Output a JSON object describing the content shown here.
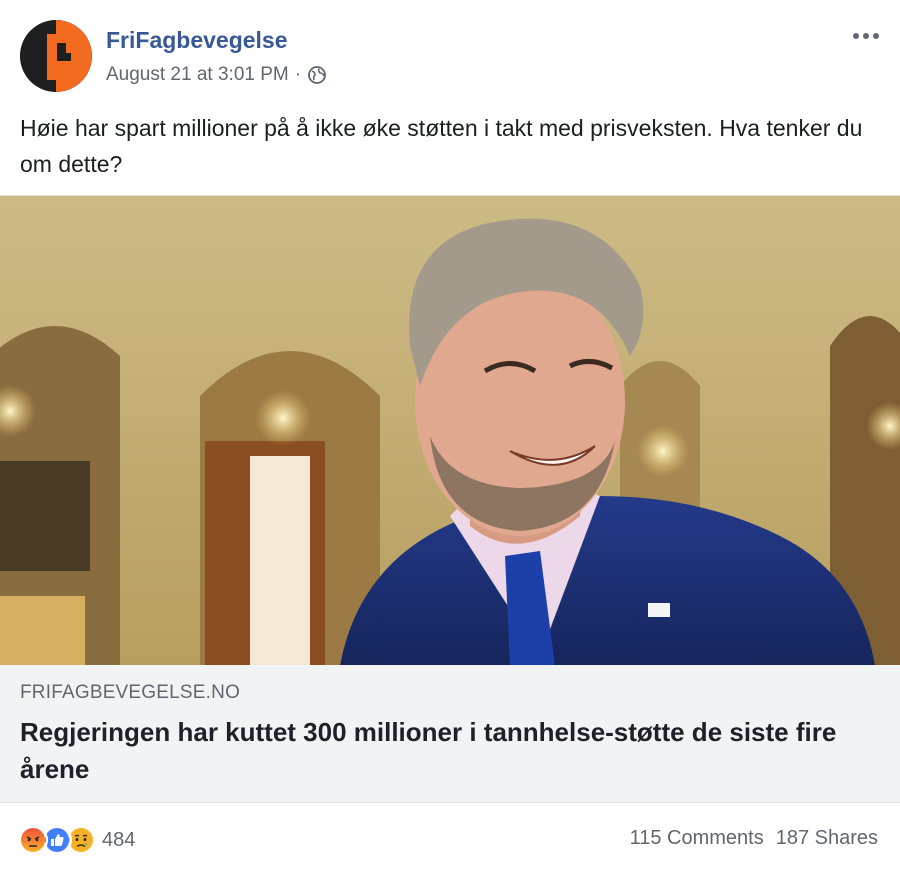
{
  "post": {
    "page_name": "FriFagbevegelse",
    "timestamp": "August 21 at 3:01 PM",
    "separator": "·",
    "text": "Høie har spart millioner på å ikke øke støtten i takt med prisveksten. Hva tenker du om dette?"
  },
  "link": {
    "domain": "FRIFAGBEVEGELSE.NO",
    "title": "Regjeringen har kuttet 300 millioner i tannhelse-støtte de siste fire årene"
  },
  "footer": {
    "reactions": [
      "angry-icon",
      "like-icon",
      "sad-icon"
    ],
    "reaction_count": "484",
    "comments": "115 Comments",
    "shares": "187 Shares"
  },
  "colors": {
    "brand": "#385898",
    "avatar_orange": "#f26b21",
    "like_blue": "#4080ff",
    "angry_red": "#e9710f",
    "sad_yellow": "#f7b125"
  }
}
